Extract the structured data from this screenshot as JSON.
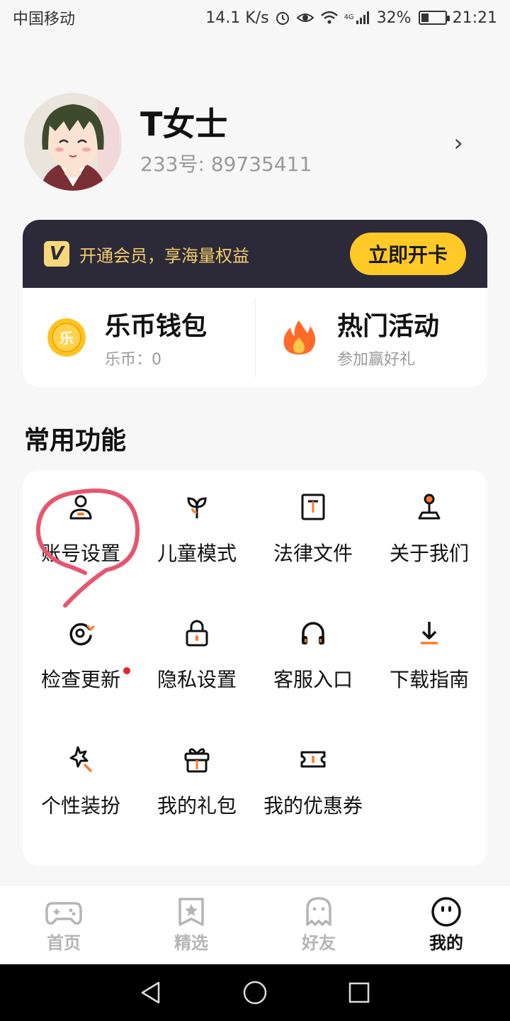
{
  "status_bar": {
    "carrier": "中国移动",
    "net_speed": "14.1 K/s",
    "network_type": "4G",
    "battery": "32%",
    "battery_level": 0.32,
    "time": "21:21"
  },
  "profile": {
    "nickname": "T女士",
    "user_id": "233号: 89735411",
    "arrow": "›"
  },
  "vip": {
    "logo_letter": "V",
    "promo_text": "开通会员，享海量权益",
    "button_label": "立即开卡"
  },
  "wallet": {
    "title": "乐币钱包",
    "subtitle": "乐币：0",
    "coin_glyph": "乐"
  },
  "events": {
    "title": "热门活动",
    "subtitle": "参加赢好礼"
  },
  "section": {
    "title": "常用功能"
  },
  "functions": [
    {
      "label": "账号设置",
      "icon": "user-icon"
    },
    {
      "label": "儿童模式",
      "icon": "sprout-icon"
    },
    {
      "label": "法律文件",
      "icon": "document-icon"
    },
    {
      "label": "关于我们",
      "icon": "joystick-icon"
    },
    {
      "label": "检查更新",
      "icon": "refresh-icon",
      "badge": true
    },
    {
      "label": "隐私设置",
      "icon": "lock-icon"
    },
    {
      "label": "客服入口",
      "icon": "headphones-icon"
    },
    {
      "label": "下载指南",
      "icon": "download-icon"
    },
    {
      "label": "个性装扮",
      "icon": "magic-wand-icon"
    },
    {
      "label": "我的礼包",
      "icon": "gift-icon"
    },
    {
      "label": "我的优惠券",
      "icon": "ticket-icon"
    }
  ],
  "bottom_nav": [
    {
      "label": "首页",
      "icon": "gamepad-icon",
      "active": false
    },
    {
      "label": "精选",
      "icon": "star-bookmark-icon",
      "active": false
    },
    {
      "label": "好友",
      "icon": "ghost-icon",
      "active": false
    },
    {
      "label": "我的",
      "icon": "smiley-icon",
      "active": true
    }
  ],
  "colors": {
    "accent": "#ff7a2a",
    "vip_bg": "#2c2a38",
    "vip_gold": "#f2cc6b",
    "vip_button": "#ffc928",
    "badge_red": "#e8232b",
    "annotation": "#e6566f"
  }
}
